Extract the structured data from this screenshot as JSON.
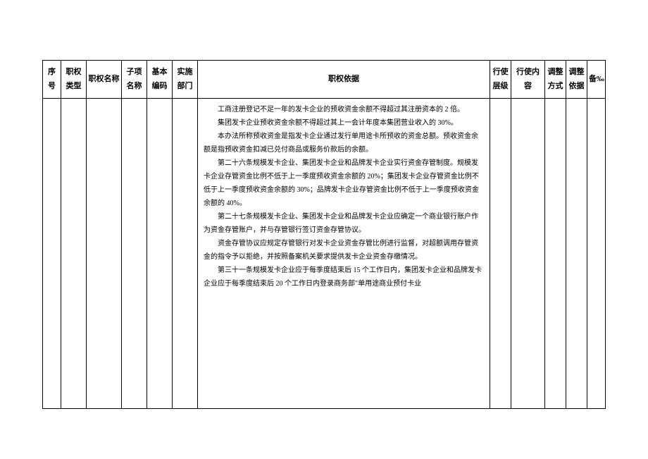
{
  "headers": {
    "seq": "序号",
    "type": "职权类型",
    "name": "职权名称",
    "subitem": "子项名称",
    "code": "基本编码",
    "dept": "实施部门",
    "basis": "职权依据",
    "level": "行使层级",
    "content": "行使内容",
    "adjmethod": "调整方式",
    "adjbasis": "调整依据",
    "remark": "备‰"
  },
  "basis": {
    "p1": "工商注册登记不足一年的发卡企业的预收资金余额不得超过其注册资本的 2 倍。",
    "p2": "集团发卡企业预收资金余额不得超过其上一会计年度本集团营业收入的 30%。",
    "p3": "本办法所称预收资金是指发卡企业通过发行单用途卡所预收的资金总额。预收资金余额是指预收资金扣减已兑付商品或服务价款后的余额。",
    "p4": "第二十六条规模发卡企业、集团发卡企业和品牌发卡企业实行资金存管制度。规模发卡企业存管资金比例不低于上一季度预收资金余额的 20%；集团发卡企业存管资金比例不低于上一季度预收资金余额的 30%；品牌发卡企业存管资金比例不低于上一季度预收资金余额的 40%。",
    "p5": "第二十七条规模发卡企业、集团发卡企业和品牌发卡企业应确定一个商业银行账户作为资金存管账户，并与存管银行签订资金存管协议。",
    "p6": "资金存管协议应规定存管银行对发卡企业资金存管比例进行监督，对超额调用存管资金的指令予以拒绝，并按照备案机关要求提供发卡企业资金存缴情况。",
    "p7": "第三十一条规模发卡企业应于每季度结束后 15 个工作日内，集团发卡企业和品牌发卡企业应于每季度结束后 20 个工作日内登录商务部\"单用途商业预付卡业"
  }
}
